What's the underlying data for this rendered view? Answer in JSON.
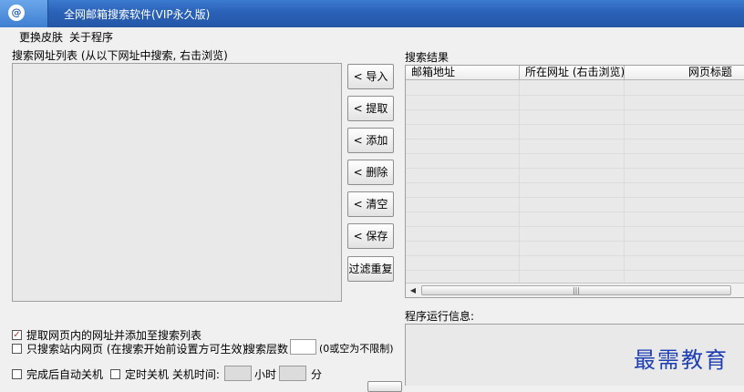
{
  "window": {
    "title": "全网邮箱搜索软件(VIP永久版)",
    "icon": "app-logo-icon"
  },
  "menu": {
    "items": [
      "更换皮肤",
      "关于程序"
    ]
  },
  "url_panel": {
    "label": "搜索网址列表 (从以下网址中搜索, 右击浏览)"
  },
  "buttons": {
    "import": "< 导入",
    "extract": "< 提取",
    "add": "< 添加",
    "delete": "< 删除",
    "clear": "< 清空",
    "save": "< 保存",
    "dedupe": "过滤重复"
  },
  "results": {
    "label": "搜索结果",
    "columns": [
      "邮箱地址",
      "所在网址 (右击浏览)",
      "网页标题"
    ],
    "scroll_thumb": "|||"
  },
  "info": {
    "label": "程序运行信息:"
  },
  "options": {
    "extract_links": {
      "label": "提取网页内的网址并添加至搜索列表",
      "checked": true
    },
    "site_only": {
      "label": "只搜索站内网页 (在搜索开始前设置方可生效)",
      "checked": false
    },
    "depth_label": "搜索层数",
    "depth_value": "",
    "depth_hint": "(0或空为不限制)",
    "auto_shutdown": {
      "label": "完成后自动关机",
      "checked": false
    },
    "timed_shutdown": {
      "label": "定时关机 关机时间:",
      "checked": false
    },
    "hour_label": "小时",
    "minute_label": "分"
  },
  "watermark": "最需教育"
}
